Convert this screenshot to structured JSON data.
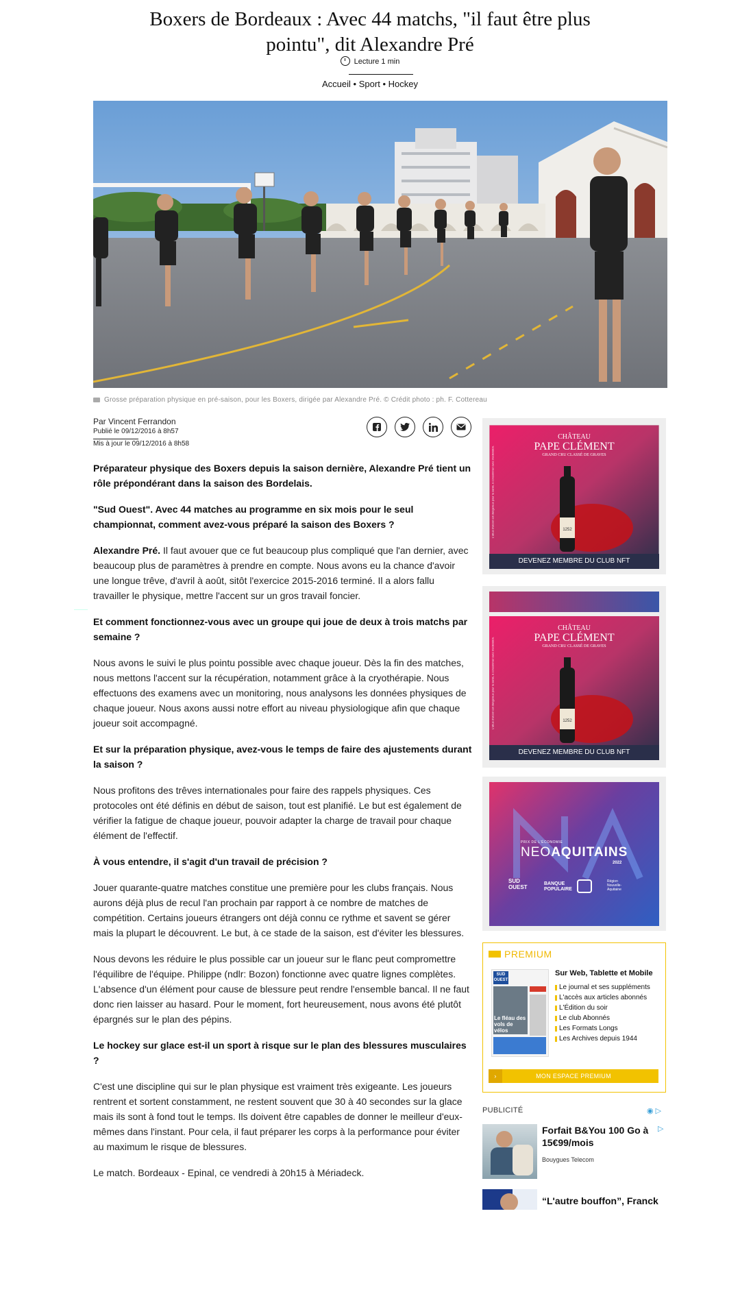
{
  "article": {
    "title": "Boxers de Bordeaux : Avec 44 matchs, \"il faut être plus pointu\", dit Alexandre Pré",
    "read_time": "Lecture 1 min",
    "breadcrumb": [
      "Accueil",
      "Sport",
      "Hockey"
    ],
    "breadcrumb_sep": "•",
    "caption": "Grosse préparation physique en pré-saison, pour les Boxers, dirigée par Alexandre Pré. © Crédit photo : ph. F. Cottereau",
    "author": "Par Vincent Ferrandon",
    "published": "Publié le 09/12/2016 à 8h57",
    "updated": "Mis à jour le 09/12/2016 à 8h58",
    "share_icons": [
      "facebook-icon",
      "twitter-icon",
      "linkedin-icon",
      "email-icon"
    ],
    "lead": "Préparateur physique des Boxers depuis la saison dernière, Alexandre Pré tient un rôle prépondérant dans la saison des Bordelais.",
    "q1": "\"Sud Ouest\". Avec 44 matches au programme en six mois pour le seul championnat, comment avez-vous préparé la saison des Boxers ?",
    "a1_speaker": "Alexandre Pré.",
    "a1": " Il faut avouer que ce fut beaucoup plus compliqué que l'an dernier, avec beaucoup plus de paramètres à prendre en compte. Nous avons eu la chance d'avoir une longue trêve, d'avril à août, sitôt l'exercice 2015-2016 terminé. Il a alors fallu travailler le physique, mettre l'accent sur un gros travail foncier.",
    "q2": "Et comment fonctionnez-vous avec un groupe qui joue de deux à trois matchs par semaine ?",
    "a2": "Nous avons le suivi le plus pointu possible avec chaque joueur. Dès la fin des matches, nous mettons l'accent sur la récupération, notamment grâce à la cryothérapie. Nous effectuons des examens avec un monitoring, nous analysons les données physiques de chaque joueur. Nous axons aussi notre effort au niveau physiologique afin que chaque joueur soit accompagné.",
    "q3": "Et sur la préparation physique, avez-vous le temps de faire des ajustements durant la saison ?",
    "a3": "Nous profitons des trêves internationales pour faire des rappels physiques. Ces protocoles ont été définis en début de saison, tout est planifié. Le but est également de vérifier la fatigue de chaque joueur, pouvoir adapter la charge de travail pour chaque élément de l'effectif.",
    "q4": "À vous entendre, il s'agit d'un travail de précision ?",
    "a4": "Jouer quarante-quatre matches constitue une première pour les clubs français. Nous aurons déjà plus de recul l'an prochain par rapport à ce nombre de matches de compétition. Certains joueurs étrangers ont déjà connu ce rythme et savent se gérer mais la plupart le découvrent. Le but, à ce stade de la saison, est d'éviter les blessures.",
    "a4b": "Nous devons les réduire le plus possible car un joueur sur le flanc peut compromettre l'équilibre de l'équipe. Philippe (ndlr: Bozon) fonctionne avec quatre lignes complètes. L'absence d'un élément pour cause de blessure peut rendre l'ensemble bancal. Il ne faut donc rien laisser au hasard. Pour le moment, fort heureusement, nous avons été plutôt épargnés sur le plan des pépins.",
    "q5": "Le hockey sur glace est-il un sport à risque sur le plan des blessures musculaires ?",
    "a5": "C'est une discipline qui sur le plan physique est vraiment très exigeante. Les joueurs rentrent et sortent constamment, ne restent souvent que 30 à 40 secondes sur la glace mais ils sont à fond tout le temps. Ils doivent être capables de donner le meilleur d'eux-mêmes dans l'instant. Pour cela, il faut préparer les corps à la performance pour éviter au maximum le risque de blessures.",
    "closing": "Le match. Bordeaux - Epinal, ce vendredi à 20h15 à Mériadeck."
  },
  "ads": {
    "wine": {
      "brand_line1": "CHÂTEAU",
      "brand_line2": "PAPE CLÉMENT",
      "brand_line3": "GRAND CRU CLASSÉ DE GRAVES",
      "bottle_year": "1252",
      "cta": "DEVENEZ MEMBRE DU CLUB NFT",
      "side_text": "L'abus d'alcool est dangereux pour la santé, à consommer avec modération."
    },
    "neo": {
      "kicker": "PRIX DE L'ÉCONOMIE",
      "title_a": "NEO",
      "title_b": "AQUITAINS",
      "year": "2022",
      "sponsor1_a": "SUD",
      "sponsor1_b": "OUEST",
      "sponsor2_a": "BANQUE",
      "sponsor2_b": "POPULAIRE",
      "sponsor3_a": "Région",
      "sponsor3_b": "Nouvelle-",
      "sponsor3_c": "Aquitaine"
    }
  },
  "premium": {
    "label": "PREMIUM",
    "subtitle": "Sur Web, Tablette et Mobile",
    "items": [
      "Le journal et ses suppléments",
      "L'accès aux articles abonnés",
      "L'Édition du soir",
      "Le club Abonnés",
      "Les Formats Longs",
      "Les Archives depuis 1944"
    ],
    "button": "MON ESPACE PREMIUM",
    "button_arrow": "›",
    "paper_name_a": "SUD",
    "paper_name_b": "OUEST",
    "paper_headline": "Le fléau des vols de vélos"
  },
  "publicite": {
    "label": "PUBLICITÉ",
    "icons": "◉ ▷",
    "promo1_title": "Forfait B&You 100 Go à 15€99/mois",
    "promo1_source": "Bouygues Telecom",
    "promo1_play": "▷",
    "promo2_title": "“L'autre bouffon”, Franck Dubosc"
  }
}
